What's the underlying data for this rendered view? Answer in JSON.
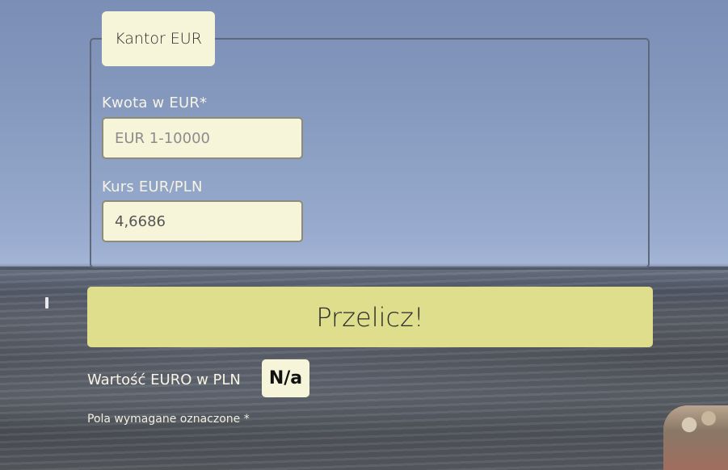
{
  "form": {
    "legend": "Kantor EUR",
    "amount": {
      "label": "Kwota w EUR*",
      "placeholder": "EUR 1-10000",
      "value": ""
    },
    "rate": {
      "label": "Kurs EUR/PLN",
      "placeholder": "",
      "value": "4,6686"
    },
    "submit_label": "Przelicz!"
  },
  "result": {
    "label": "Wartość EURO w PLN",
    "value": "N/a"
  },
  "note": "Pola wymagane oznaczone *"
}
